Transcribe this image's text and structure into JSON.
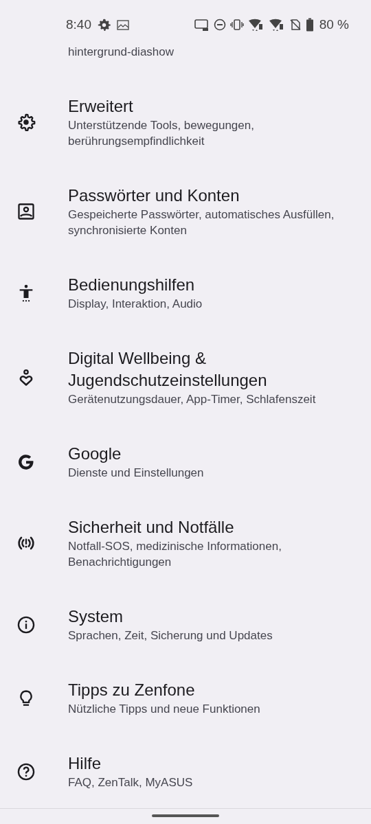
{
  "status_bar": {
    "time": "8:40",
    "battery": "80 %"
  },
  "partial_item": {
    "subtitle": "hintergrund-diashow"
  },
  "items": [
    {
      "title": "Erweitert",
      "subtitle": "Unterstützende Tools, bewegungen, berührungsempfindlichkeit"
    },
    {
      "title": "Passwörter und Konten",
      "subtitle": "Gespeicherte Passwörter, automatisches Ausfüllen, synchronisierte Konten"
    },
    {
      "title": "Bedienungshilfen",
      "subtitle": "Display, Interaktion, Audio"
    },
    {
      "title": "Digital Wellbeing & Jugendschutzeinstellungen",
      "subtitle": "Gerätenutzungsdauer, App-Timer, Schlafenszeit"
    },
    {
      "title": "Google",
      "subtitle": "Dienste und Einstellungen"
    },
    {
      "title": "Sicherheit und Notfälle",
      "subtitle": "Notfall-SOS, medizinische Informationen, Benachrichtigungen"
    },
    {
      "title": "System",
      "subtitle": "Sprachen, Zeit, Sicherung und Updates"
    },
    {
      "title": "Tipps zu Zenfone",
      "subtitle": "Nützliche Tipps und neue Funktionen"
    },
    {
      "title": "Hilfe",
      "subtitle": "FAQ, ZenTalk, MyASUS"
    }
  ]
}
